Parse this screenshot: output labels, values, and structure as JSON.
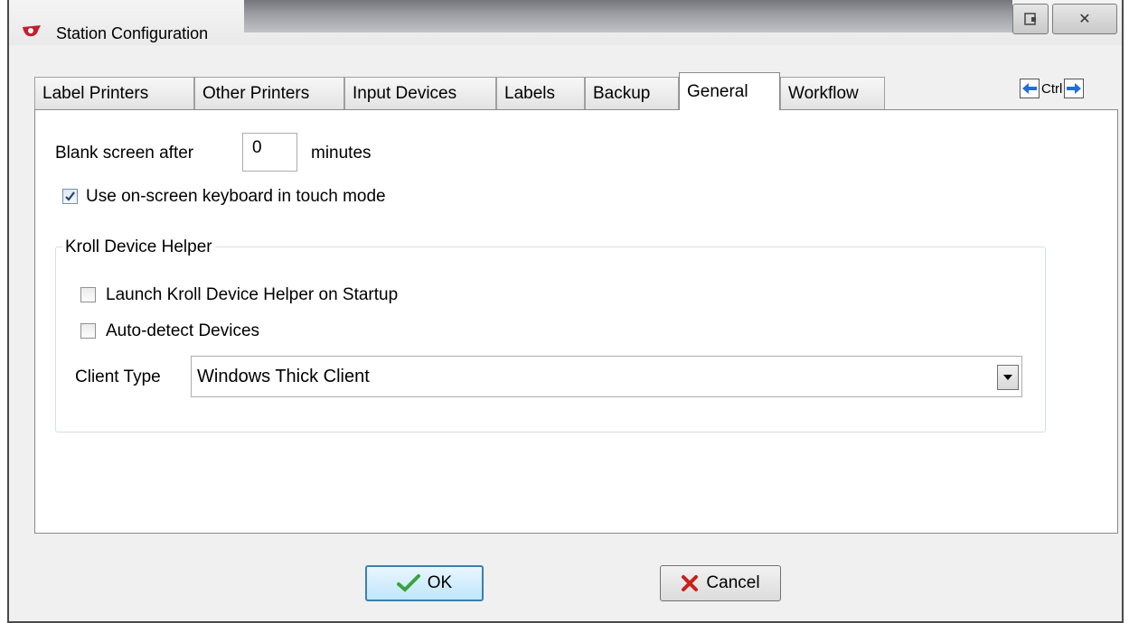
{
  "window": {
    "title": "Station Configuration"
  },
  "tabs": [
    {
      "label": "Label Printers"
    },
    {
      "label": "Other Printers"
    },
    {
      "label": "Input Devices"
    },
    {
      "label": "Labels"
    },
    {
      "label": "Backup"
    },
    {
      "label": "General",
      "active": true
    },
    {
      "label": "Workflow"
    }
  ],
  "tab_nav": {
    "label": "Ctrl"
  },
  "general": {
    "blank_screen_label": "Blank screen after",
    "blank_screen_value": "0",
    "minutes_label": "minutes",
    "onscreen_keyboard_label": "Use on-screen keyboard in touch mode",
    "onscreen_keyboard_checked": true
  },
  "device_helper": {
    "group_title": "Kroll Device Helper",
    "launch_label": "Launch Kroll Device Helper on Startup",
    "launch_checked": false,
    "autodetect_label": "Auto-detect Devices",
    "autodetect_checked": false,
    "client_type_label": "Client Type",
    "client_type_value": "Windows Thick Client"
  },
  "buttons": {
    "ok": "OK",
    "cancel": "Cancel"
  },
  "colors": {
    "ok_check": "#3aa33a",
    "cancel_x": "#c8201c",
    "arrow": "#1e6fd9",
    "app_icon": "#c21f2f"
  }
}
